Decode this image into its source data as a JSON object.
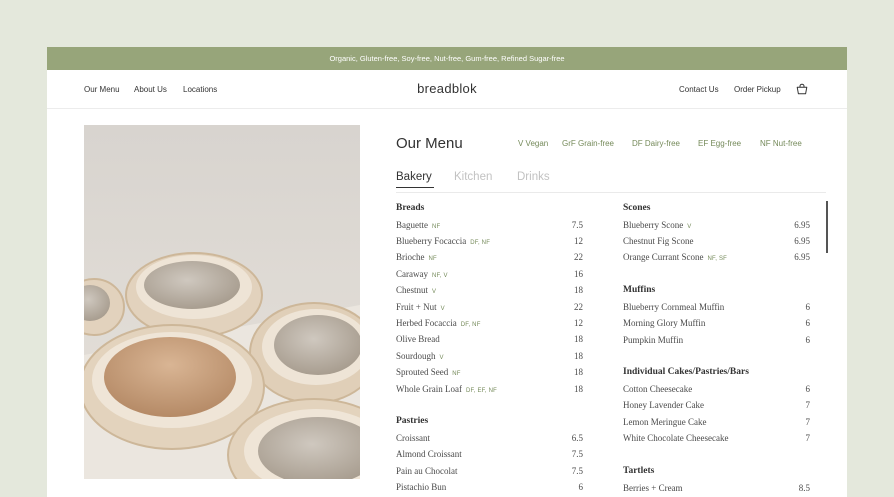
{
  "banner": "Organic, Gluten-free, Soy-free, Nut-free, Gum-free, Refined Sugar-free",
  "nav": {
    "left": [
      "Our Menu",
      "About Us",
      "Locations"
    ],
    "brand": "breadblok",
    "right": [
      "Contact Us",
      "Order Pickup"
    ],
    "cart_icon": "shopping-bag-icon"
  },
  "menu": {
    "title": "Our Menu",
    "legend": [
      "V Vegan",
      "GrF Grain-free",
      "DF Dairy-free",
      "EF Egg-free",
      "NF Nut-free"
    ],
    "tabs": [
      "Bakery",
      "Kitchen",
      "Drinks"
    ],
    "active_tab": "Bakery",
    "left_column": [
      {
        "title": "Breads",
        "items": [
          {
            "name": "Baguette",
            "tags": "NF",
            "price": "7.5"
          },
          {
            "name": "Blueberry Focaccia",
            "tags": "DF, NF",
            "price": "12"
          },
          {
            "name": "Brioche",
            "tags": "NF",
            "price": "22"
          },
          {
            "name": "Caraway",
            "tags": "NF, V",
            "price": "16"
          },
          {
            "name": "Chestnut",
            "tags": "V",
            "price": "18"
          },
          {
            "name": "Fruit + Nut",
            "tags": "V",
            "price": "22"
          },
          {
            "name": "Herbed Focaccia",
            "tags": "DF, NF",
            "price": "12"
          },
          {
            "name": "Olive Bread",
            "tags": "",
            "price": "18"
          },
          {
            "name": "Sourdough",
            "tags": "V",
            "price": "18"
          },
          {
            "name": "Sprouted Seed",
            "tags": "NF",
            "price": "18"
          },
          {
            "name": "Whole Grain Loaf",
            "tags": "DF, EF, NF",
            "price": "18"
          }
        ]
      },
      {
        "title": "Pastries",
        "items": [
          {
            "name": "Croissant",
            "tags": "",
            "price": "6.5"
          },
          {
            "name": "Almond Croissant",
            "tags": "",
            "price": "7.5"
          },
          {
            "name": "Pain au Chocolat",
            "tags": "",
            "price": "7.5"
          },
          {
            "name": "Pistachio Bun",
            "tags": "",
            "price": "6"
          }
        ]
      }
    ],
    "right_column": [
      {
        "title": "Scones",
        "items": [
          {
            "name": "Blueberry Scone",
            "tags": "V",
            "price": "6.95"
          },
          {
            "name": "Chestnut Fig Scone",
            "tags": "",
            "price": "6.95"
          },
          {
            "name": "Orange Currant Scone",
            "tags": "NF, SF",
            "price": "6.95"
          }
        ]
      },
      {
        "title": "Muffins",
        "items": [
          {
            "name": "Blueberry Cornmeal Muffin",
            "tags": "",
            "price": "6"
          },
          {
            "name": "Morning Glory Muffin",
            "tags": "",
            "price": "6"
          },
          {
            "name": "Pumpkin Muffin",
            "tags": "",
            "price": "6"
          }
        ]
      },
      {
        "title": "Individual Cakes/Pastries/Bars",
        "items": [
          {
            "name": "Cotton Cheesecake",
            "tags": "",
            "price": "6"
          },
          {
            "name": "Honey Lavender Cake",
            "tags": "",
            "price": "7"
          },
          {
            "name": "Lemon Meringue Cake",
            "tags": "",
            "price": "7"
          },
          {
            "name": "White Chocolate Cheesecake",
            "tags": "",
            "price": "7"
          }
        ]
      },
      {
        "title": "Tartlets",
        "items": [
          {
            "name": "Berries + Cream",
            "tags": "",
            "price": "8.5"
          }
        ]
      }
    ]
  },
  "colors": {
    "banner_bg": "#97a57a",
    "accent_green": "#758a5a",
    "page_bg": "#e4e8dc"
  }
}
